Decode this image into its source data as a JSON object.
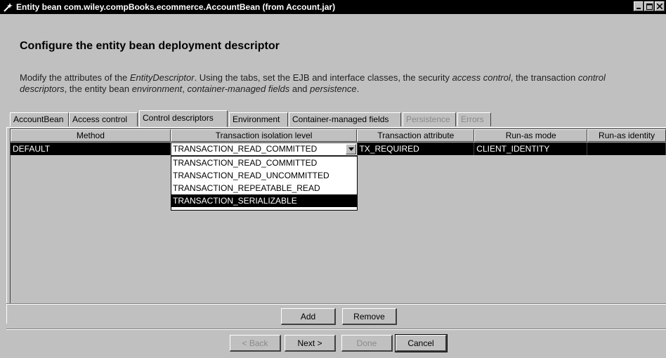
{
  "window": {
    "title": "Entity bean com.wiley.compBooks.ecommerce.AccountBean (from Account.jar)",
    "app_icon": "wizard-wand-icon",
    "controls": [
      "minimize-icon",
      "maximize-icon",
      "close-icon"
    ]
  },
  "heading": "Configure the entity bean deployment descriptor",
  "description": {
    "p1": "Modify the attributes of the ",
    "em1": "EntityDescriptor",
    "p2": ". Using the tabs, set the EJB and interface classes, the security ",
    "em2": "access control",
    "p3": ", the transaction ",
    "em3": "control descriptors",
    "p4": ", the entity bean ",
    "em4": "environment",
    "p5": ", ",
    "em5": "container-managed fields",
    "p6": " and ",
    "em6": "persistence",
    "p7": "."
  },
  "tabs": [
    {
      "label": "AccountBean",
      "state": "normal"
    },
    {
      "label": "Access control",
      "state": "normal"
    },
    {
      "label": "Control descriptors",
      "state": "active"
    },
    {
      "label": "Environment",
      "state": "normal"
    },
    {
      "label": "Container-managed fields",
      "state": "normal"
    },
    {
      "label": "Persistence",
      "state": "disabled"
    },
    {
      "label": "Errors",
      "state": "disabled"
    }
  ],
  "table": {
    "columns": [
      "Method",
      "Transaction isolation level",
      "Transaction attribute",
      "Run-as mode",
      "Run-as identity"
    ],
    "rows": [
      {
        "method": "DEFAULT",
        "isolation": "TRANSACTION_READ_COMMITTED",
        "attribute": "TX_REQUIRED",
        "run_as_mode": "CLIENT_IDENTITY",
        "run_as_identity": ""
      }
    ],
    "isolation_options": [
      "TRANSACTION_READ_COMMITTED",
      "TRANSACTION_READ_UNCOMMITTED",
      "TRANSACTION_REPEATABLE_READ",
      "TRANSACTION_SERIALIZABLE"
    ],
    "highlighted_option": "TRANSACTION_SERIALIZABLE"
  },
  "table_buttons": {
    "add": "Add",
    "remove": "Remove"
  },
  "wizard_buttons": {
    "back": "< Back",
    "next": "Next >",
    "done": "Done",
    "cancel": "Cancel"
  }
}
